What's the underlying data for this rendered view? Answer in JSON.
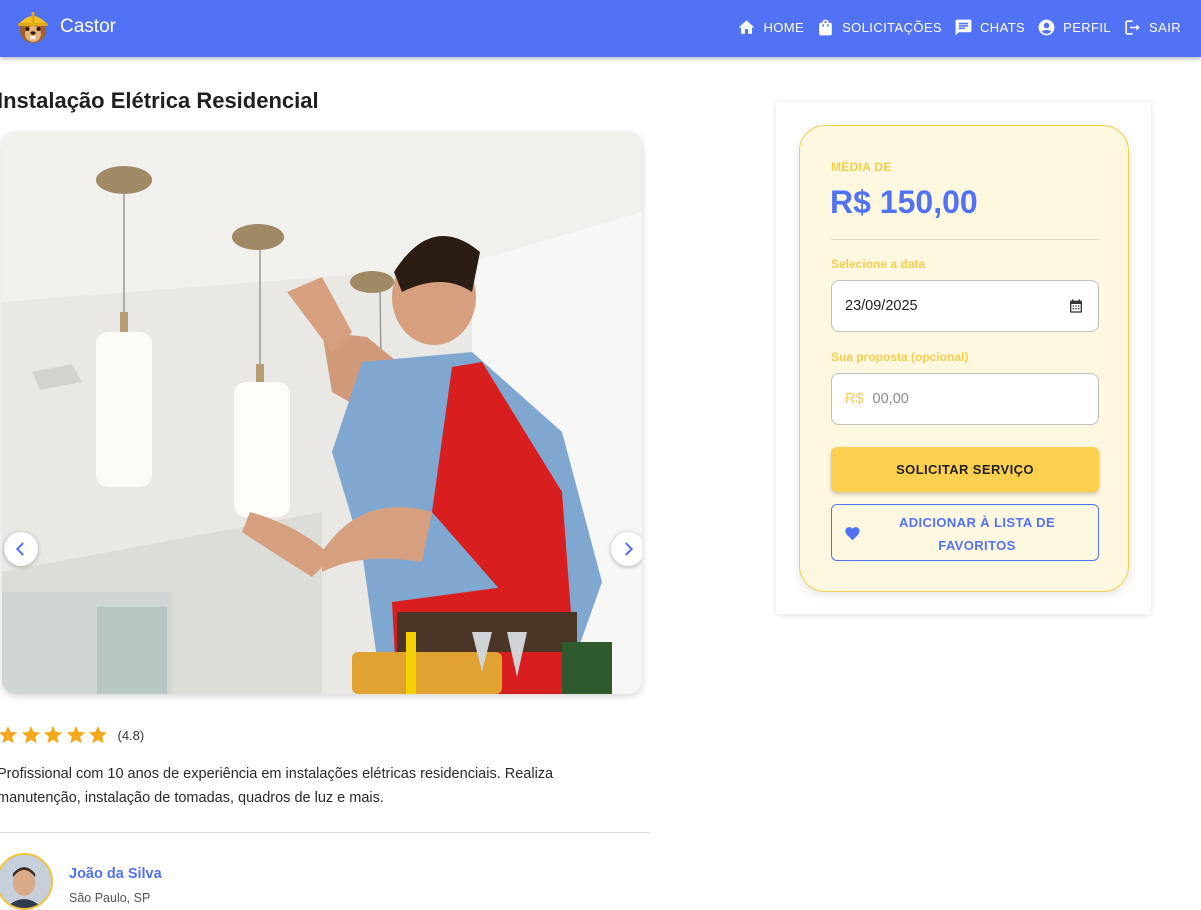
{
  "app": {
    "name": "Castor"
  },
  "nav": {
    "items": [
      {
        "label": "HOME",
        "icon": "home-icon"
      },
      {
        "label": "SOLICITAÇÕES",
        "icon": "shopping-bag-icon"
      },
      {
        "label": "CHATS",
        "icon": "chat-icon"
      },
      {
        "label": "PERFIL",
        "icon": "account-circle-icon"
      },
      {
        "label": "SAIR",
        "icon": "logout-icon"
      }
    ]
  },
  "service": {
    "title": "Instalação Elétrica Residencial",
    "rating_text": "(4.8)",
    "rating_value": 4.8,
    "rating_max": 5,
    "description": "Profissional com 10 anos de experiência em instalações elétricas residenciais. Realiza manutenção, instalação de tomadas, quadros de luz e mais."
  },
  "provider": {
    "name": "João da Silva",
    "location": "São Paulo, SP"
  },
  "booking": {
    "average_label": "MÉDIA DE",
    "average_value": "R$ 150,00",
    "date_label": "Selecione a data",
    "date_value": "23/09/2025",
    "proposal_label": "Sua proposta (opcional)",
    "proposal_prefix": "R$",
    "proposal_placeholder": "00,00",
    "request_button": "SOLICITAR SERVIÇO",
    "favorite_button": "ADICIONAR À LISTA DE FAVORITOS"
  },
  "colors": {
    "primary": "#5272f5",
    "accent": "#fdd04f",
    "star": "#f5a81b",
    "panel": "#fff8e1"
  }
}
